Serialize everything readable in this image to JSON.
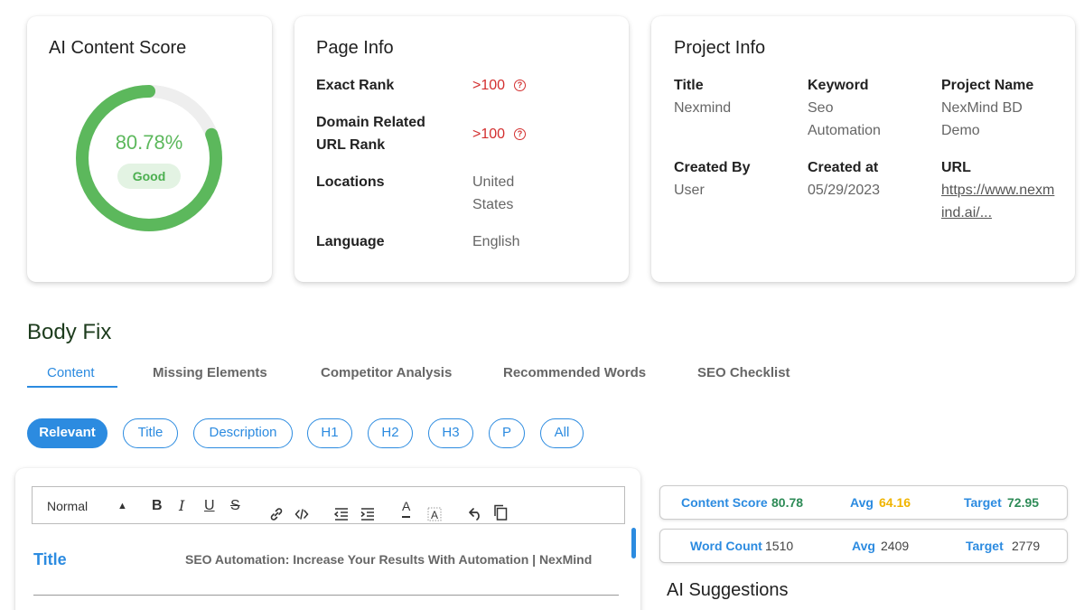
{
  "score_card": {
    "title": "AI Content Score",
    "score_text": "80.78%",
    "score_fraction": 0.8078,
    "badge": "Good",
    "colors": {
      "ring": "#5cb85c",
      "track": "#eeeeee"
    }
  },
  "page_info": {
    "title": "Page Info",
    "rows": [
      {
        "label": "Exact Rank",
        "value": ">100"
      },
      {
        "label": "Domain Related URL Rank",
        "value": ">100"
      },
      {
        "label": "Locations",
        "value": "United States"
      },
      {
        "label": "Language",
        "value": "English"
      }
    ],
    "help_icon": "?"
  },
  "project_info": {
    "title": "Project Info",
    "fields": [
      {
        "label": "Title",
        "value": "Nexmind"
      },
      {
        "label": "Keyword",
        "value": "Seo Automation"
      },
      {
        "label": "Project Name",
        "value": "NexMind BD Demo"
      },
      {
        "label": "Created By",
        "value": "User"
      },
      {
        "label": "Created at",
        "value": "05/29/2023"
      },
      {
        "label": "URL",
        "value": "https://www.nexmind.ai/..."
      }
    ]
  },
  "body_fix": {
    "title": "Body Fix",
    "tabs": [
      "Content",
      "Missing Elements",
      "Competitor Analysis",
      "Recommended Words",
      "SEO Checklist"
    ],
    "active_tab": "Content",
    "chips": [
      "Relevant",
      "Title",
      "Description",
      "H1",
      "H2",
      "H3",
      "P",
      "All"
    ],
    "active_chip": "Relevant"
  },
  "editor": {
    "format": "Normal",
    "title_label": "Title",
    "title_value": "SEO Automation: Increase Your Results With Automation | NexMind"
  },
  "metrics": {
    "content_score": {
      "label": "Content Score",
      "value": "80.78",
      "avg_label": "Avg",
      "avg": "64.16",
      "target_label": "Target",
      "target": "72.95"
    },
    "word_count": {
      "label": "Word Count",
      "value": "1510",
      "avg_label": "Avg",
      "avg": "2409",
      "target_label": "Target",
      "target": "2779"
    }
  },
  "ai_suggestions": {
    "title": "AI Suggestions"
  },
  "colors": {
    "accent": "#2c8be0",
    "good": "#2e8b57",
    "avg": "#f0b400",
    "danger": "#d32f2f"
  }
}
